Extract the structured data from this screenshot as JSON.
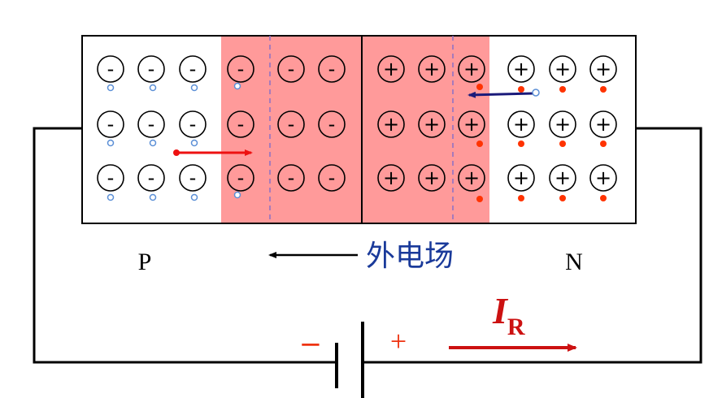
{
  "labels": {
    "p_region": "P",
    "n_region": "N",
    "external_field": "外电场",
    "battery_negative": "−",
    "battery_positive": "+",
    "current_symbol": "I",
    "current_subscript": "R"
  },
  "ions": {
    "negative_symbol": "-",
    "positive_symbol": "+"
  },
  "colors": {
    "depletion_region": "#ff9a9a",
    "hole": "#5b8fd6",
    "electron": "#ff3300",
    "wire": "#000000",
    "field_label": "#1a3a9a",
    "current": "#cc1111",
    "battery_sign": "#ee3311",
    "hole_arrow": "#ee1111",
    "electron_arrow": "#1a1a7a",
    "dashed_boundary": "#8a6fc6"
  }
}
